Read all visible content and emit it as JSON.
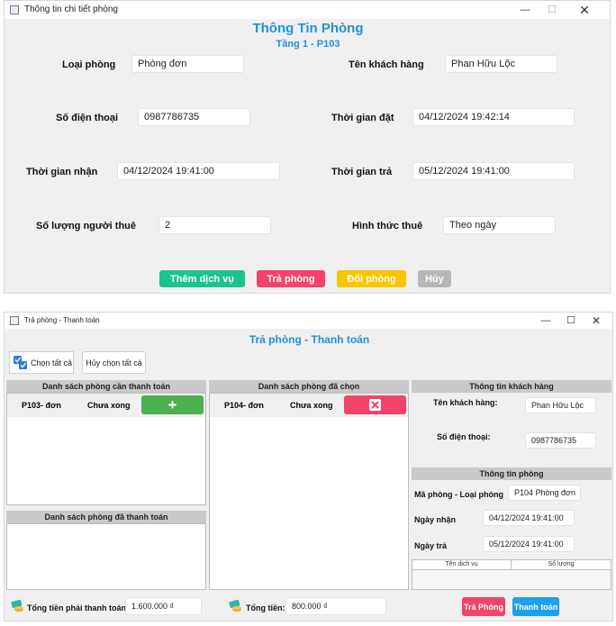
{
  "room_window": {
    "window_title": "Thông tin chi tiết phòng",
    "heading": "Thông Tin Phòng",
    "subheading": "Tầng 1 - P103",
    "fields": {
      "room_type_label": "Loại phòng",
      "room_type_value": "Phòng đơn",
      "customer_name_label": "Tên khách hàng",
      "customer_name_value": "Phan Hữu Lộc",
      "phone_label": "Số điện thoại",
      "phone_value": "0987786735",
      "booking_time_label": "Thời gian đặt",
      "booking_time_value": "04/12/2024 19:42:14",
      "checkin_label": "Thời gian nhận",
      "checkin_value": "04/12/2024 19:41:00",
      "checkout_label": "Thời gian trả",
      "checkout_value": "05/12/2024 19:41:00",
      "guests_label": "Số lượng người thuê",
      "guests_value": "2",
      "rent_type_label": "Hình thức thuê",
      "rent_type_value": "Theo ngày"
    },
    "buttons": {
      "add_service": "Thêm dịch vụ",
      "checkout": "Trả phòng",
      "change_room": "Đổi phòng",
      "cancel": "Hủy"
    },
    "colors": {
      "heading": "#1e90e0",
      "add_service": "#1bc48f",
      "checkout": "#f2436a",
      "change_room": "#f7c600",
      "cancel": "#b7b7b7"
    }
  },
  "payment_window": {
    "window_title": "Trả phòng - Thanh toán",
    "heading": "Trả phòng - Thanh toán",
    "select_all": "Chọn tất cả",
    "deselect_all": "Hủy chọn tất cả",
    "pending_section": {
      "title": "Danh sách phòng cần thanh toán",
      "rows": [
        {
          "room": "P103- đơn",
          "status": "Chưa xong"
        }
      ]
    },
    "selected_section": {
      "title": "Danh sách phòng đã chọn",
      "rows": [
        {
          "room": "P104- đơn",
          "status": "Chưa xong"
        }
      ]
    },
    "paid_section": {
      "title": "Danh sách phòng đã thanh toán"
    },
    "customer_info": {
      "title": "Thông tin khách hàng",
      "name_label": "Tên khách hàng:",
      "name_value": "Phan Hữu Lộc",
      "phone_label": "Số điện thoại:",
      "phone_value": "0987786735"
    },
    "room_info": {
      "title": "Thông tin phòng",
      "room_label": "Mã phòng - Loại phòng",
      "room_value": "P104 Phòng đơn",
      "checkin_label": "Ngày nhận",
      "checkin_value": "04/12/2024 19:41:00",
      "checkout_label": "Ngày trả",
      "checkout_value": "05/12/2024 19:41:00",
      "services_columns": [
        "Tên dịch vụ",
        "Số lượng"
      ]
    },
    "totals": {
      "must_pay_label": "Tổng tiền phải thanh toán:",
      "must_pay_value": "1.600.000 ₫",
      "total_label": "Tổng tiền:",
      "total_value": "800.000 ₫"
    },
    "buttons": {
      "return_room": "Trả Phòng",
      "pay": "Thanh toán"
    },
    "colors": {
      "heading": "#1e90e0",
      "add": "#4caf50",
      "remove": "#f2436a",
      "return_room": "#f2436a",
      "pay": "#1ea0f0"
    }
  }
}
